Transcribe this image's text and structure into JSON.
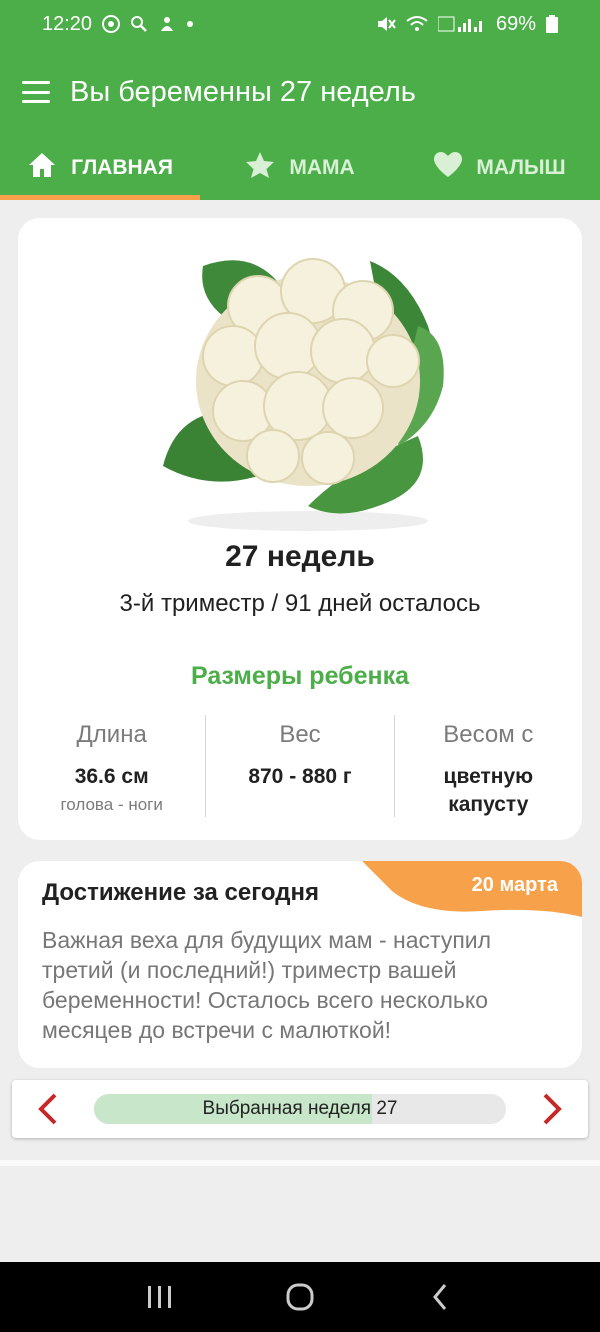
{
  "status_bar": {
    "time": "12:20",
    "battery": "69%"
  },
  "app_bar": {
    "title": "Вы беременны 27 недель"
  },
  "tabs": [
    {
      "label": "ГЛАВНАЯ",
      "icon": "home-icon",
      "active": true
    },
    {
      "label": "МАМА",
      "icon": "star-icon",
      "active": false
    },
    {
      "label": "МАЛЫШ",
      "icon": "heart-icon",
      "active": false
    }
  ],
  "main_card": {
    "image": "cauliflower",
    "week_title": "27 недель",
    "trimester": "3-й триместр / 91 дней осталось",
    "sizes_title": "Размеры ребенка",
    "metrics": [
      {
        "label": "Длина",
        "value": "36.6 см",
        "sub": "голова - ноги"
      },
      {
        "label": "Вес",
        "value": "870 - 880 г",
        "sub": ""
      },
      {
        "label": "Весом с",
        "value": "цветную капусту",
        "sub": ""
      }
    ]
  },
  "achievement": {
    "title": "Достижение за сегодня",
    "date": "20 марта",
    "text": "Важная веха для будущих мам - наступил третий (и последний!) триместр вашей беременности! Осталось всего несколько месяцев до встречи с малюткой!"
  },
  "week_selector": {
    "label": "Выбранная неделя 27",
    "progress": 0.675
  },
  "colors": {
    "primary": "#4cae48",
    "accent": "#f7a24a",
    "arrow": "#c62828"
  }
}
